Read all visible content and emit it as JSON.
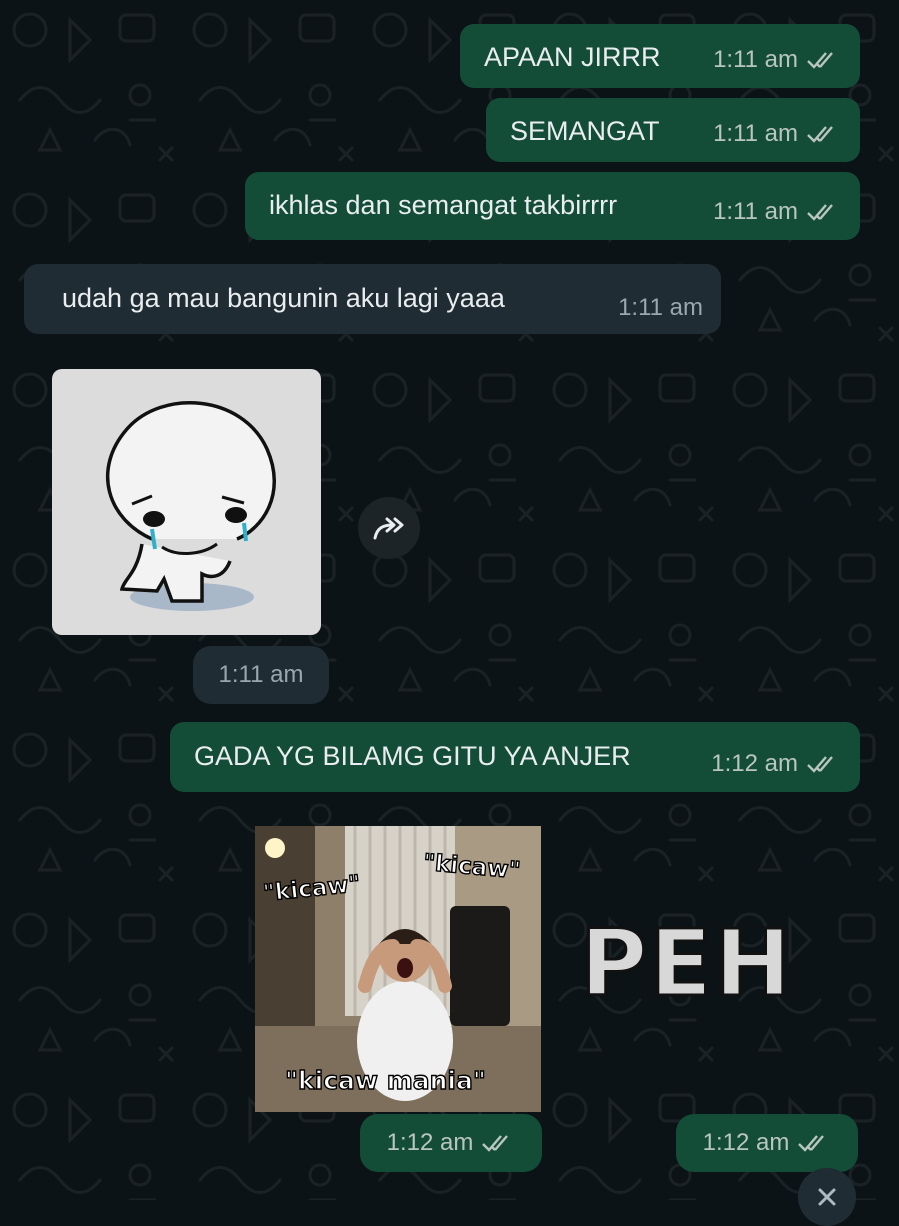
{
  "messages": [
    {
      "text": "APAAN JIRRR",
      "time": "1:11 am",
      "direction": "outgoing",
      "status": "read"
    },
    {
      "text": "SEMANGAT",
      "time": "1:11 am",
      "direction": "outgoing",
      "status": "read"
    },
    {
      "text": "ikhlas dan semangat takbirrrr",
      "time": "1:11 am",
      "direction": "outgoing",
      "status": "read"
    },
    {
      "text": "udah ga mau bangunin aku lagi yaaa",
      "time": "1:11 am",
      "direction": "incoming"
    },
    {
      "type": "sticker",
      "sticker": "crying-doodle-sticker",
      "time": "1:11 am",
      "direction": "incoming"
    },
    {
      "text": "GADA YG BILAMG GITU YA ANJER",
      "time": "1:12 am",
      "direction": "outgoing",
      "status": "read"
    },
    {
      "type": "sticker",
      "sticker": "kicaw-meme-sticker",
      "labels": [
        "\"kicaw\"",
        "\"kicaw\"",
        "\"kicaw mania\""
      ],
      "time": "1:12 am",
      "direction": "outgoing",
      "status": "read"
    },
    {
      "type": "sticker",
      "sticker": "peh-text-sticker",
      "text": "PEH",
      "time": "1:12 am",
      "direction": "outgoing",
      "status": "read"
    }
  ],
  "icons": {
    "forward": "forward-icon",
    "read_ticks": "double-check-icon",
    "scroll": "close-icon"
  },
  "colors": {
    "background": "#0c1317",
    "outgoing_bubble": "#144d37",
    "incoming_bubble": "#1f2c33",
    "read_tick": "#b9c6c0"
  }
}
